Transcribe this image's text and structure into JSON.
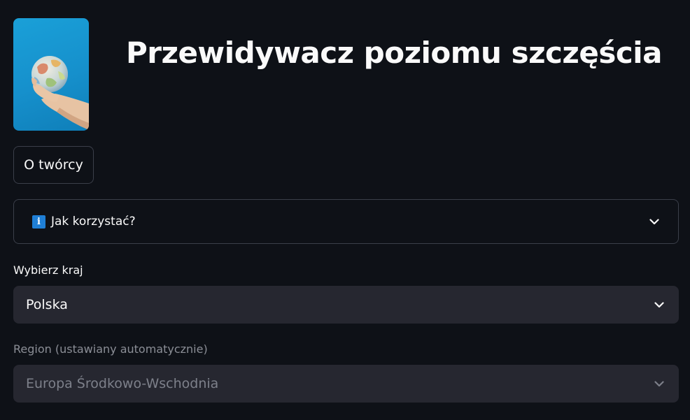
{
  "header": {
    "title": "Przewidywacz poziomu szczęścia",
    "image": {
      "subject": "hand holding a globe on blue background",
      "accent_color": "#1a9dd6"
    }
  },
  "author_button": {
    "label": "O twórcy"
  },
  "help_expander": {
    "icon": "info-icon",
    "icon_glyph": "i",
    "label": "Jak korzystać?",
    "expanded": false
  },
  "country_select": {
    "label": "Wybierz kraj",
    "value": "Polska"
  },
  "region_select": {
    "label": "Region (ustawiany automatycznie)",
    "value": "Europa Środkowo-Wschodnia",
    "disabled": true
  },
  "colors": {
    "background": "#0e1117",
    "input_bg": "#262730",
    "border": "#3b3f4a",
    "text": "#fafafa",
    "muted_text": "#7d808a",
    "info_blue": "#1f7fd6"
  }
}
